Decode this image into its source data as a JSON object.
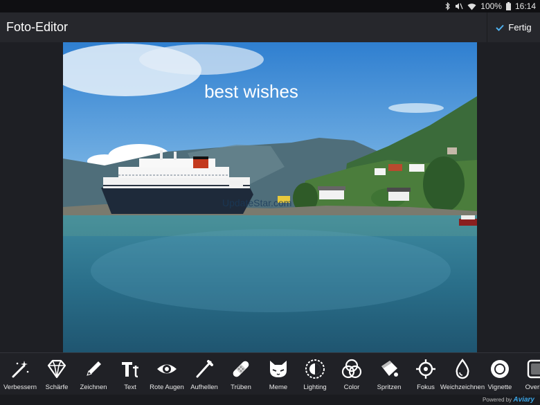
{
  "status": {
    "battery": "100%",
    "time": "16:14"
  },
  "header": {
    "title": "Foto-Editor",
    "done_label": "Fertig"
  },
  "photo": {
    "caption": "best wishes",
    "watermark": "UpdateStar.com"
  },
  "tools": [
    {
      "label": "Verbessern",
      "icon": "magic-wand-icon"
    },
    {
      "label": "Schärfe",
      "icon": "diamond-icon"
    },
    {
      "label": "Zeichnen",
      "icon": "pencil-icon"
    },
    {
      "label": "Text",
      "icon": "text-icon"
    },
    {
      "label": "Rote Augen",
      "icon": "eye-icon"
    },
    {
      "label": "Aufhellen",
      "icon": "brush-icon"
    },
    {
      "label": "Trüben",
      "icon": "bandage-icon"
    },
    {
      "label": "Meme",
      "icon": "cat-face-icon"
    },
    {
      "label": "Lighting",
      "icon": "lighting-icon"
    },
    {
      "label": "Color",
      "icon": "color-circles-icon"
    },
    {
      "label": "Spritzen",
      "icon": "splash-icon"
    },
    {
      "label": "Fokus",
      "icon": "focus-icon"
    },
    {
      "label": "Weichzeichnen",
      "icon": "drop-icon"
    },
    {
      "label": "Vignette",
      "icon": "vignette-icon"
    },
    {
      "label": "Overlay",
      "icon": "overlay-icon"
    }
  ],
  "footer": {
    "powered_by": "Powered by",
    "brand": "Aviary"
  },
  "colors": {
    "accent": "#3aa6e8",
    "toolbar_bg": "#202126",
    "actionbar_bg": "#26272c"
  }
}
